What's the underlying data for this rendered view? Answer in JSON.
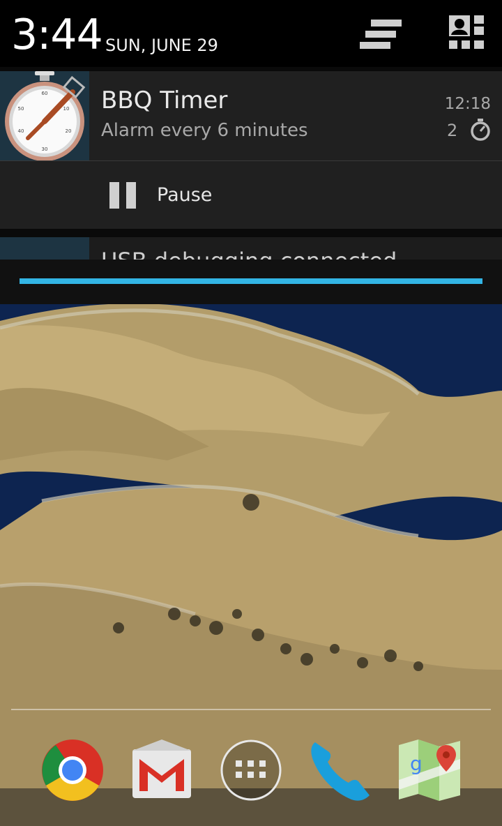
{
  "status": {
    "time": "3:44",
    "date": "SUN, JUNE 29",
    "icons": [
      "clear-all-icon",
      "quick-settings-icon"
    ]
  },
  "notification": {
    "app_icon": "stopwatch-icon",
    "title": "BBQ Timer",
    "text": "Alarm every 6 minutes",
    "time": "12:18",
    "count": "2",
    "small_icon": "stopwatch-small-icon",
    "action": {
      "icon": "pause-icon",
      "label": "Pause"
    }
  },
  "peek_notification": {
    "text": "USB debugging connected"
  },
  "colors": {
    "accent": "#33b5e5",
    "panel": "#202020"
  },
  "dock": {
    "apps": [
      "chrome-icon",
      "gmail-icon",
      "app-drawer-icon",
      "phone-icon",
      "maps-icon"
    ]
  }
}
